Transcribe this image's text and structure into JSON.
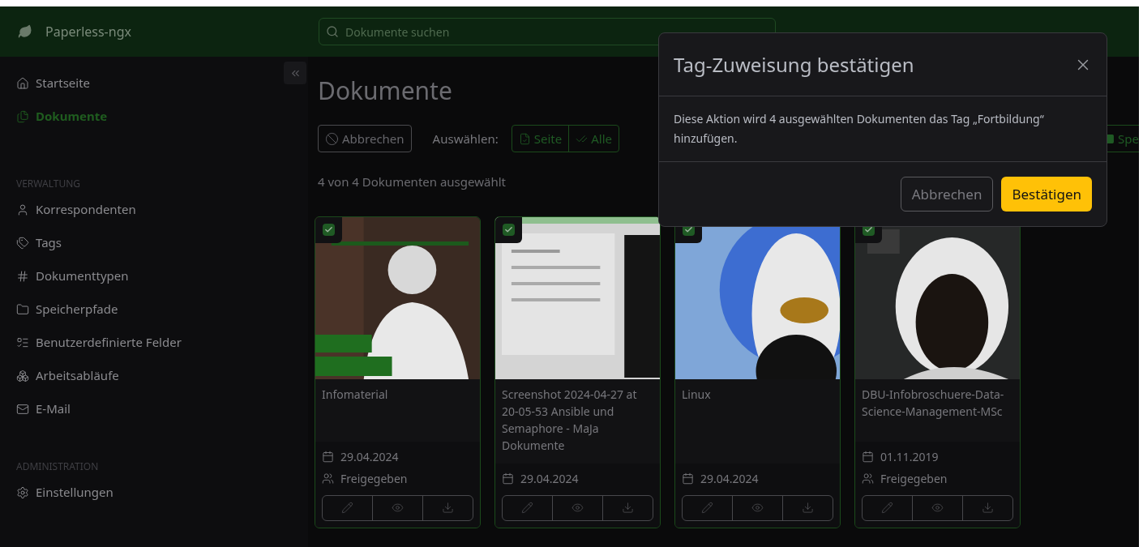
{
  "header": {
    "app_name": "Paperless-ngx",
    "search": {
      "placeholder": "Dokumente suchen"
    }
  },
  "sidebar": {
    "main_items": [
      {
        "label": "Startseite",
        "selected": false
      },
      {
        "label": "Dokumente",
        "selected": true
      }
    ],
    "sections": [
      {
        "heading": "VERWALTUNG",
        "items": [
          {
            "label": "Korrespondenten",
            "selected": false
          },
          {
            "label": "Tags",
            "selected": false
          },
          {
            "label": "Dokumenttypen",
            "selected": false
          },
          {
            "label": "Speicherpfade",
            "selected": false
          },
          {
            "label": "Benutzerdefinierte Felder",
            "selected": false
          },
          {
            "label": "Arbeitsabläufe",
            "selected": false
          },
          {
            "label": "E-Mail",
            "selected": false
          }
        ]
      },
      {
        "heading": "ADMINISTRATION",
        "items": [
          {
            "label": "Einstellungen",
            "selected": false
          }
        ]
      }
    ]
  },
  "page": {
    "title": "Dokumente",
    "cancel_button": "Abbrechen",
    "select_label": "Auswählen:",
    "select_buttons": [
      "Seite",
      "Alle"
    ],
    "partial_button": "Spe",
    "selection_status": "4 von 4 Dokumenten ausgewählt",
    "cards": [
      {
        "title": "Infomaterial",
        "checked": true,
        "date": "29.04.2024",
        "shared": "Freigegeben"
      },
      {
        "title": "Screenshot 2024-04-27 at 20-05-53 Ansible und Semaphore - MaJa Dokumente",
        "checked": true,
        "date": "29.04.2024"
      },
      {
        "title": "Linux",
        "checked": true,
        "date": "29.04.2024"
      },
      {
        "title": "DBU-Infobroschuere-Data-Science-Management-MSc",
        "checked": true,
        "date": "01.11.2019",
        "shared": "Freigegeben"
      }
    ]
  },
  "modal": {
    "title": "Tag-Zuweisung bestätigen",
    "body": "Diese Aktion wird 4 ausgewählten Dokumenten das Tag „Fortbildung“ hinzufügen.",
    "buttons": [
      {
        "label": "Abbrechen",
        "kind": "secondary"
      },
      {
        "label": "Bestätigen",
        "kind": "primary"
      }
    ]
  }
}
